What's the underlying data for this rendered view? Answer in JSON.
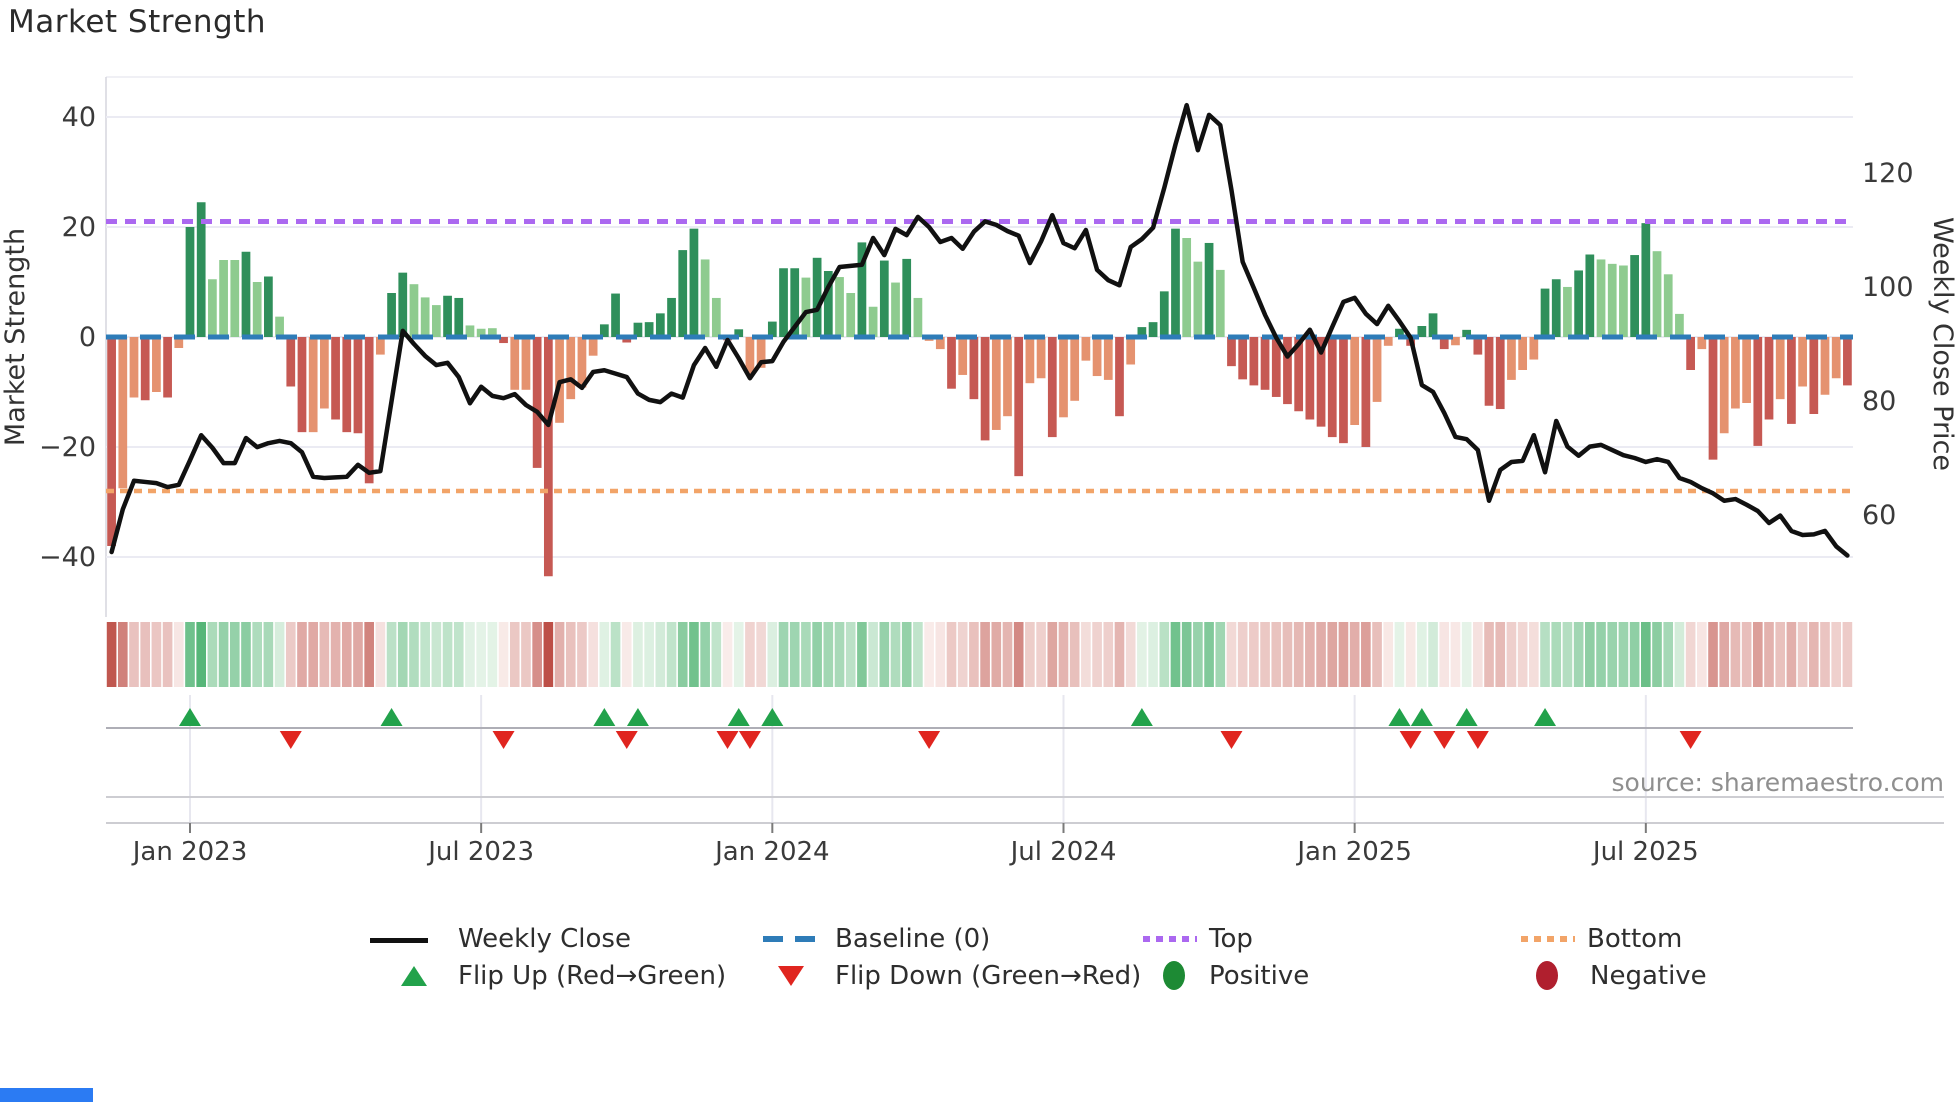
{
  "title": "Market Strength",
  "source": "source: sharemaestro.com",
  "axes": {
    "left": {
      "label": "Market Strength",
      "ticks": [
        "40",
        "20",
        "0",
        "−20",
        "−40"
      ],
      "tick_values": [
        40,
        20,
        0,
        -20,
        -40
      ]
    },
    "right": {
      "label": "Weekly Close Price",
      "ticks": [
        "120",
        "100",
        "80",
        "60"
      ],
      "tick_values": [
        120,
        100,
        80,
        60
      ]
    },
    "x": {
      "tick_labels": [
        "Jan 2023",
        "Jul 2023",
        "Jan 2024",
        "Jul 2024",
        "Jan 2025",
        "Jul 2025"
      ],
      "tick_weeks": [
        7,
        33,
        59,
        85,
        111,
        137
      ]
    }
  },
  "chart_data": {
    "type": "combo",
    "n_weeks": 156,
    "panels": [
      "strength_bars",
      "weekly_close_line",
      "strength_heatmap",
      "flip_markers"
    ],
    "strength": {
      "name": "Market Strength",
      "type": "bar",
      "ylim": [
        -47,
        45
      ],
      "values": [
        -38,
        -27.5,
        -11,
        -11.5,
        -10,
        -11,
        -2,
        20,
        24.5,
        10.5,
        14,
        14,
        15.5,
        10,
        11,
        3.7,
        -9,
        -17.3,
        -17.3,
        -13,
        -15,
        -17.3,
        -17.5,
        -26.6,
        -3.2,
        8,
        11.7,
        9.6,
        7.2,
        5.8,
        7.5,
        7.1,
        2.1,
        1.5,
        1.6,
        -1.1,
        -9.6,
        -9.6,
        -23.8,
        -43.5,
        -15.6,
        -11.3,
        -9.2,
        -3.4,
        2.3,
        7.9,
        -1,
        2.6,
        2.7,
        4.3,
        7.1,
        15.8,
        19.7,
        14.1,
        7.1,
        -0.6,
        1.4,
        -6.8,
        -5.6,
        2.8,
        12.5,
        12.5,
        10.8,
        14.4,
        12,
        10.9,
        8,
        17.2,
        5.5,
        13.9,
        9.9,
        14.2,
        7.1,
        -0.7,
        -2.2,
        -9.4,
        -6.9,
        -11.3,
        -18.8,
        -16.9,
        -14.4,
        -25.3,
        -8.4,
        -7.5,
        -18.2,
        -14.6,
        -11.6,
        -4.3,
        -7.1,
        -7.8,
        -14.4,
        -5,
        1.8,
        2.7,
        8.3,
        19.7,
        18,
        13.7,
        17.1,
        12.2,
        -5.3,
        -7.7,
        -8.8,
        -9.6,
        -10.9,
        -12.2,
        -13.5,
        -15,
        -16.3,
        -18.2,
        -19.3,
        -16,
        -20,
        -11.8,
        -1.6,
        1.5,
        -1.6,
        2,
        4.3,
        -2.2,
        -1.5,
        1.3,
        -3.2,
        -12.5,
        -13.1,
        -7.8,
        -6,
        -4.1,
        8.8,
        10.5,
        9.1,
        12.1,
        15,
        14.1,
        13.3,
        13,
        14.9,
        20.7,
        15.6,
        11.4,
        4.2,
        -6,
        -2.2,
        -22.3,
        -17.5,
        -13,
        -12,
        -19.8,
        -15,
        -11.3,
        -15.8,
        -9,
        -14,
        -10.5,
        -7.5,
        -8.8
      ],
      "shade_blocks": [
        "dlldldl",
        "ddllldldl",
        "ddllddddl",
        "ddlllddlll",
        "dllddllll",
        "ddd",
        "ddddddll",
        "dd",
        "ll",
        "dddlddlldldldl",
        "lldlddlldlldllllldl",
        "ddddlldl",
        "dddddddddddldll",
        "dddddld",
        "dddlll",
        "ddlddlllddlll",
        "dldlllddldldlld"
      ]
    },
    "price": {
      "name": "Weekly Close",
      "type": "line",
      "values": [
        53.5,
        61,
        66,
        65.8,
        65.6,
        64.9,
        65.3,
        69.6,
        74,
        71.8,
        69.1,
        69.1,
        73.5,
        71.9,
        72.6,
        73,
        72.6,
        71,
        66.7,
        66.5,
        66.6,
        66.7,
        68.8,
        67.4,
        67.7,
        80,
        92.3,
        90,
        87.9,
        86.3,
        86.7,
        84.2,
        79.6,
        82.5,
        80.9,
        80.5,
        81.2,
        79.3,
        78.1,
        75.8,
        83.3,
        83.8,
        82.3,
        85.1,
        85.4,
        84.8,
        84.2,
        81.3,
        80.2,
        79.8,
        81.3,
        80.6,
        86.3,
        89.3,
        86,
        90.7,
        87.5,
        84,
        86.8,
        87,
        90.4,
        93,
        95.6,
        96,
        100,
        103.5,
        103.7,
        103.9,
        108.6,
        105.6,
        110.2,
        109.1,
        112.3,
        110.5,
        107.9,
        108.6,
        106.7,
        109.7,
        111.5,
        110.9,
        109.8,
        109,
        104.2,
        108,
        112.6,
        107.7,
        106.8,
        110,
        103,
        101.2,
        100.3,
        107,
        108.4,
        110.4,
        117.4,
        125,
        131.9,
        124,
        130.2,
        128.4,
        117,
        104.4,
        99.8,
        95.1,
        91.1,
        87.8,
        90,
        92.5,
        88.5,
        93,
        97.4,
        98.1,
        95.3,
        93.5,
        96.7,
        94,
        91.1,
        82.8,
        81.6,
        77.9,
        73.7,
        73.3,
        71.4,
        62.5,
        67.9,
        69.3,
        69.5,
        74,
        67.5,
        76.5,
        72,
        70.4,
        72,
        72.3,
        71.4,
        70.5,
        70,
        69.3,
        69.8,
        69.3,
        66.5,
        65.8,
        64.7,
        63.8,
        62.5,
        62.8,
        61.8,
        60.7,
        58.6,
        59.9,
        57.2,
        56.5,
        56.6,
        57.2,
        54.5,
        52.9
      ]
    },
    "reference_lines": {
      "baseline": 0,
      "top": 21,
      "bottom": -28
    },
    "flip_up_weeks": [
      7,
      25,
      44,
      47,
      56,
      59,
      92,
      115,
      117,
      121,
      128
    ],
    "flip_down_weeks": [
      16,
      35,
      46,
      55,
      57,
      73,
      100,
      116,
      119,
      122,
      141
    ],
    "heatmap": {
      "derived": "sign and magnitude of weekly strength values"
    }
  },
  "legend": {
    "items": [
      {
        "glyph": "black-line",
        "label": "Weekly Close"
      },
      {
        "glyph": "blue-dashes",
        "label": "Baseline (0)"
      },
      {
        "glyph": "purple-dots",
        "label": "Top"
      },
      {
        "glyph": "orange-dots",
        "label": "Bottom"
      },
      {
        "glyph": "green-triangle",
        "label": "Flip Up (Red→Green)"
      },
      {
        "glyph": "red-triangle",
        "label": "Flip Down (Green→Red)"
      },
      {
        "glyph": "green-dot",
        "label": "Positive"
      },
      {
        "glyph": "red-dot",
        "label": "Negative"
      }
    ]
  },
  "colors": {
    "bar_pos_strong": "#2f8f5b",
    "bar_pos_weak": "#8ecb8f",
    "bar_neg_strong": "#c65953",
    "bar_neg_weak": "#e5926f",
    "price_line": "#111111",
    "baseline": "#2e7cb8",
    "top_line": "#ab68f0",
    "bottom_line": "#f2a468",
    "flip_up": "#22a24b",
    "flip_down": "#e0251f",
    "legend_pos_dot": "#1d8a34",
    "legend_neg_dot": "#b01f2e",
    "heat_pos_max": "#56b678",
    "heat_neg_max": "#bd4f47",
    "grid": "#ebebf3",
    "axis_text": "#3a3a3a",
    "title_text": "#2b2b2b",
    "source_text": "#8f8f8f",
    "blue_strip": "#2b7bf3"
  }
}
